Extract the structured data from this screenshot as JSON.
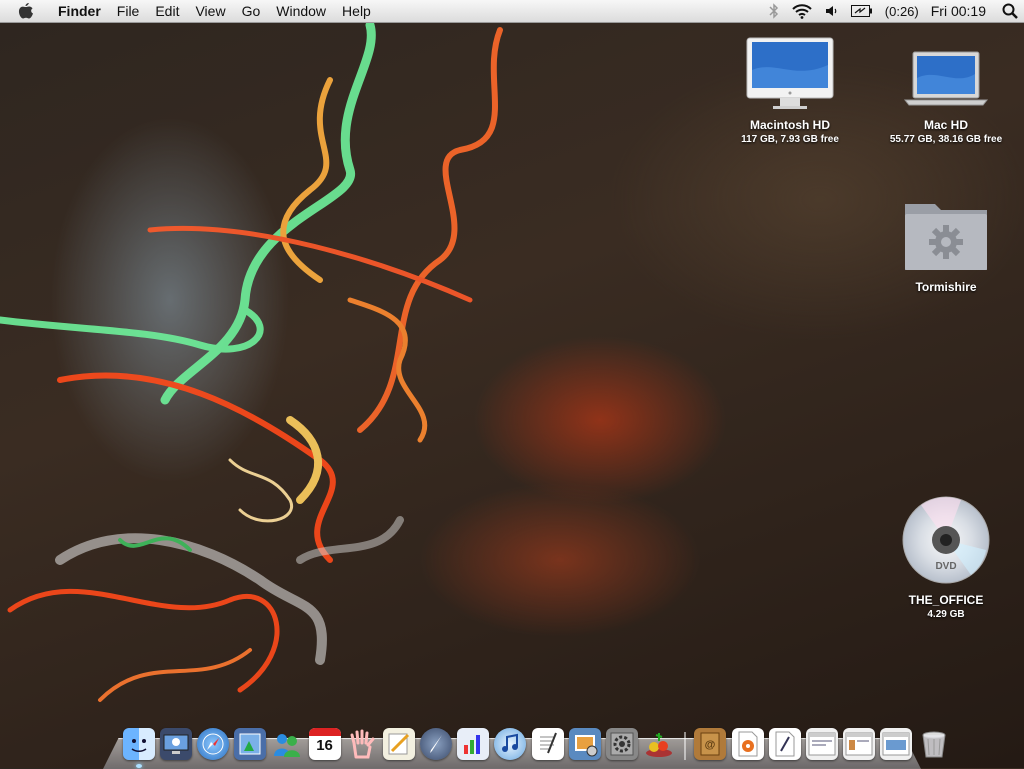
{
  "menubar": {
    "app_name": "Finder",
    "menus": [
      "File",
      "Edit",
      "View",
      "Go",
      "Window",
      "Help"
    ],
    "battery_time": "(0:26)",
    "clock": "Fri 00:19",
    "status_icons": [
      "bluetooth-icon",
      "wifi-icon",
      "volume-icon",
      "battery-icon",
      "spotlight-icon"
    ]
  },
  "desktop": {
    "icons": [
      {
        "name": "Macintosh HD",
        "sub": "117 GB, 7.93 GB free",
        "icon": "imac-drive-icon"
      },
      {
        "name": "Mac HD",
        "sub": "55.77 GB, 38.16 GB free",
        "icon": "macbook-drive-icon"
      },
      {
        "name": "Tormishire",
        "sub": "",
        "icon": "gear-folder-icon"
      },
      {
        "name": "THE_OFFICE",
        "sub": "4.29 GB",
        "icon": "dvd-disc-icon"
      }
    ]
  },
  "dock": {
    "calendar_day": "16",
    "dvd_label": "DVD",
    "items": [
      "finder",
      "remote-desktop",
      "safari",
      "preview",
      "ichat",
      "ical",
      "hand-cursor",
      "pages",
      "ink",
      "numbers",
      "itunes",
      "textedit",
      "iphoto",
      "system-preferences",
      "fruit-app",
      "address-book",
      "audio-file",
      "script",
      "window-1",
      "window-2",
      "window-3",
      "trash"
    ]
  }
}
